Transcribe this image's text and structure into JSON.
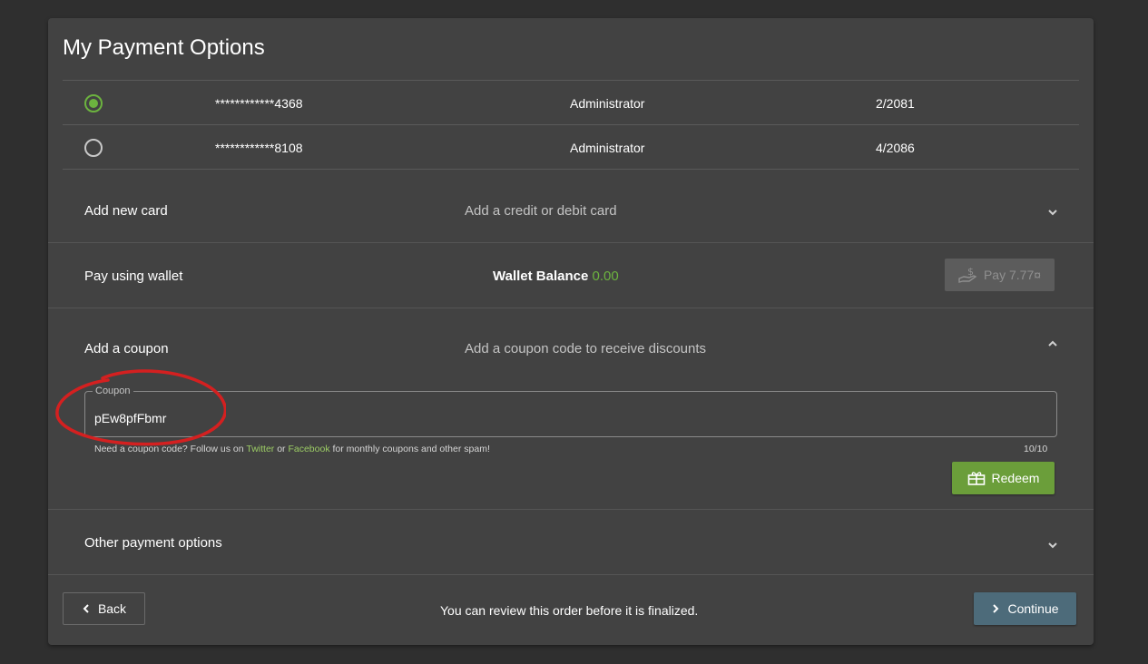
{
  "title": "My Payment Options",
  "cards": [
    {
      "number": "************4368",
      "role": "Administrator",
      "expiry": "2/2081",
      "selected": true
    },
    {
      "number": "************8108",
      "role": "Administrator",
      "expiry": "4/2086",
      "selected": false
    }
  ],
  "add_card": {
    "label": "Add new card",
    "description": "Add a credit or debit card",
    "icon": "chevron-down-icon"
  },
  "wallet": {
    "label": "Pay using wallet",
    "balance_label": "Wallet Balance",
    "balance_value": "0.00",
    "pay_label": "Pay 7.77¤",
    "pay_icon": "hand-coin-icon"
  },
  "coupon": {
    "label": "Add a coupon",
    "description": "Add a coupon code to receive discounts",
    "icon": "chevron-up-icon",
    "field_label": "Coupon",
    "value": "pEw8pfFbmr",
    "hint_prefix": "Need a coupon code? Follow us on",
    "hint_link1": "Twitter",
    "hint_mid": "or",
    "hint_link2": "Facebook",
    "hint_suffix": "for monthly coupons and other spam!",
    "counter": "10/10",
    "redeem_label": "Redeem",
    "redeem_icon": "gift-icon"
  },
  "other": {
    "label": "Other payment options",
    "icon": "chevron-down-icon"
  },
  "footer": {
    "back_label": "Back",
    "note": "You can review this order before it is finalized.",
    "continue_label": "Continue"
  },
  "colors": {
    "background": "#2f2f2f",
    "card": "#424242",
    "accent_green": "#6cb33f",
    "redeem_green": "#6b9e3a",
    "continue_blue": "#4d6b7a",
    "annotation_red": "#d42020"
  }
}
